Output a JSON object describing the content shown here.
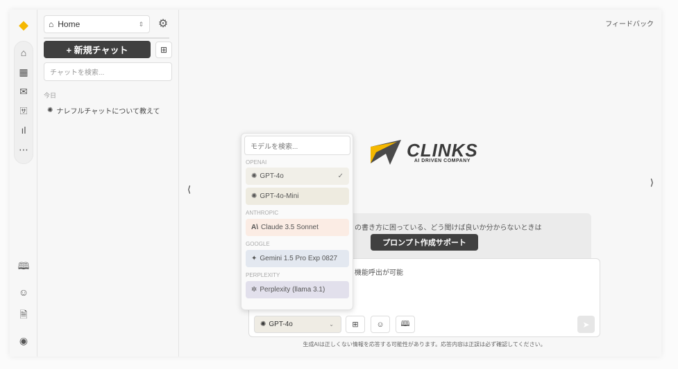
{
  "sidebar": {
    "workspace": "Home",
    "new_chat": "+ 新規チャット",
    "search_placeholder": "チャットを検索...",
    "section_today": "今日",
    "history": [
      {
        "title": "ナレフルチャットについて教えて"
      }
    ]
  },
  "header": {
    "feedback": "フィードバック"
  },
  "brand": {
    "name": "CLINKS",
    "tagline": "AI DRIVEN COMPANY",
    "accent": "#f5b800"
  },
  "help": {
    "text": "の書き方に困っている、どう聞けば良いか分からないときは",
    "button": "プロンプト作成サポート"
  },
  "input": {
    "placeholder_visible": "機能呼出が可能",
    "selected_model": "GPT-4o"
  },
  "disclaimer": "生成AIは正しくない情報を応答する可能性があります。応答内容は正誤は必ず確認してください。",
  "model_menu": {
    "search_placeholder": "モデルを検索...",
    "groups": [
      {
        "label": "OPENAI",
        "color": "#f1efe8",
        "items": [
          {
            "label": "GPT-4o",
            "selected": true
          },
          {
            "label": "GPT-4o-Mini"
          }
        ]
      },
      {
        "label": "ANTHROPIC",
        "color": "#fbece4",
        "items": [
          {
            "label": "Claude 3.5 Sonnet"
          }
        ]
      },
      {
        "label": "GOOGLE",
        "color": "#e3e8f0",
        "items": [
          {
            "label": "Gemini 1.5 Pro Exp 0827"
          }
        ]
      },
      {
        "label": "PERPLEXITY",
        "color": "#e2e0ec",
        "items": [
          {
            "label": "Perplexity (llama 3.1)"
          }
        ]
      }
    ]
  }
}
